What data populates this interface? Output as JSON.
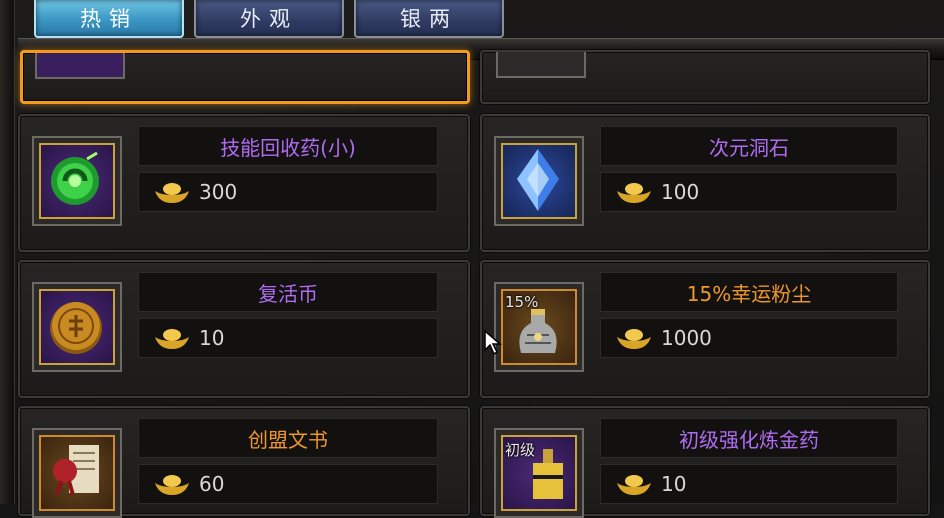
{
  "tabs": [
    {
      "label": "热销",
      "active": true
    },
    {
      "label": "外观",
      "active": false
    },
    {
      "label": "银两",
      "active": false
    }
  ],
  "items": [
    {
      "name": "技能回收药(小)",
      "price": "300",
      "name_color": "purple",
      "icon": "green-orb-icon",
      "badge": ""
    },
    {
      "name": "次元洞石",
      "price": "100",
      "name_color": "purple",
      "icon": "blue-crystal-icon",
      "badge": ""
    },
    {
      "name": "复活币",
      "price": "10",
      "name_color": "purple",
      "icon": "gold-coin-icon",
      "badge": ""
    },
    {
      "name": "15%幸运粉尘",
      "price": "1000",
      "name_color": "orange",
      "icon": "dust-bag-icon",
      "badge": "15%"
    },
    {
      "name": "创盟文书",
      "price": "60",
      "name_color": "orange",
      "icon": "scroll-seal-icon",
      "badge": ""
    },
    {
      "name": "初级强化炼金药",
      "price": "10",
      "name_color": "purple",
      "icon": "potion-bottle-icon",
      "badge": "初级"
    }
  ],
  "colors": {
    "purple": "#b06cf0",
    "orange": "#f0972a",
    "selected_border": "#f39a1c",
    "active_tab": "#3b97c2"
  }
}
